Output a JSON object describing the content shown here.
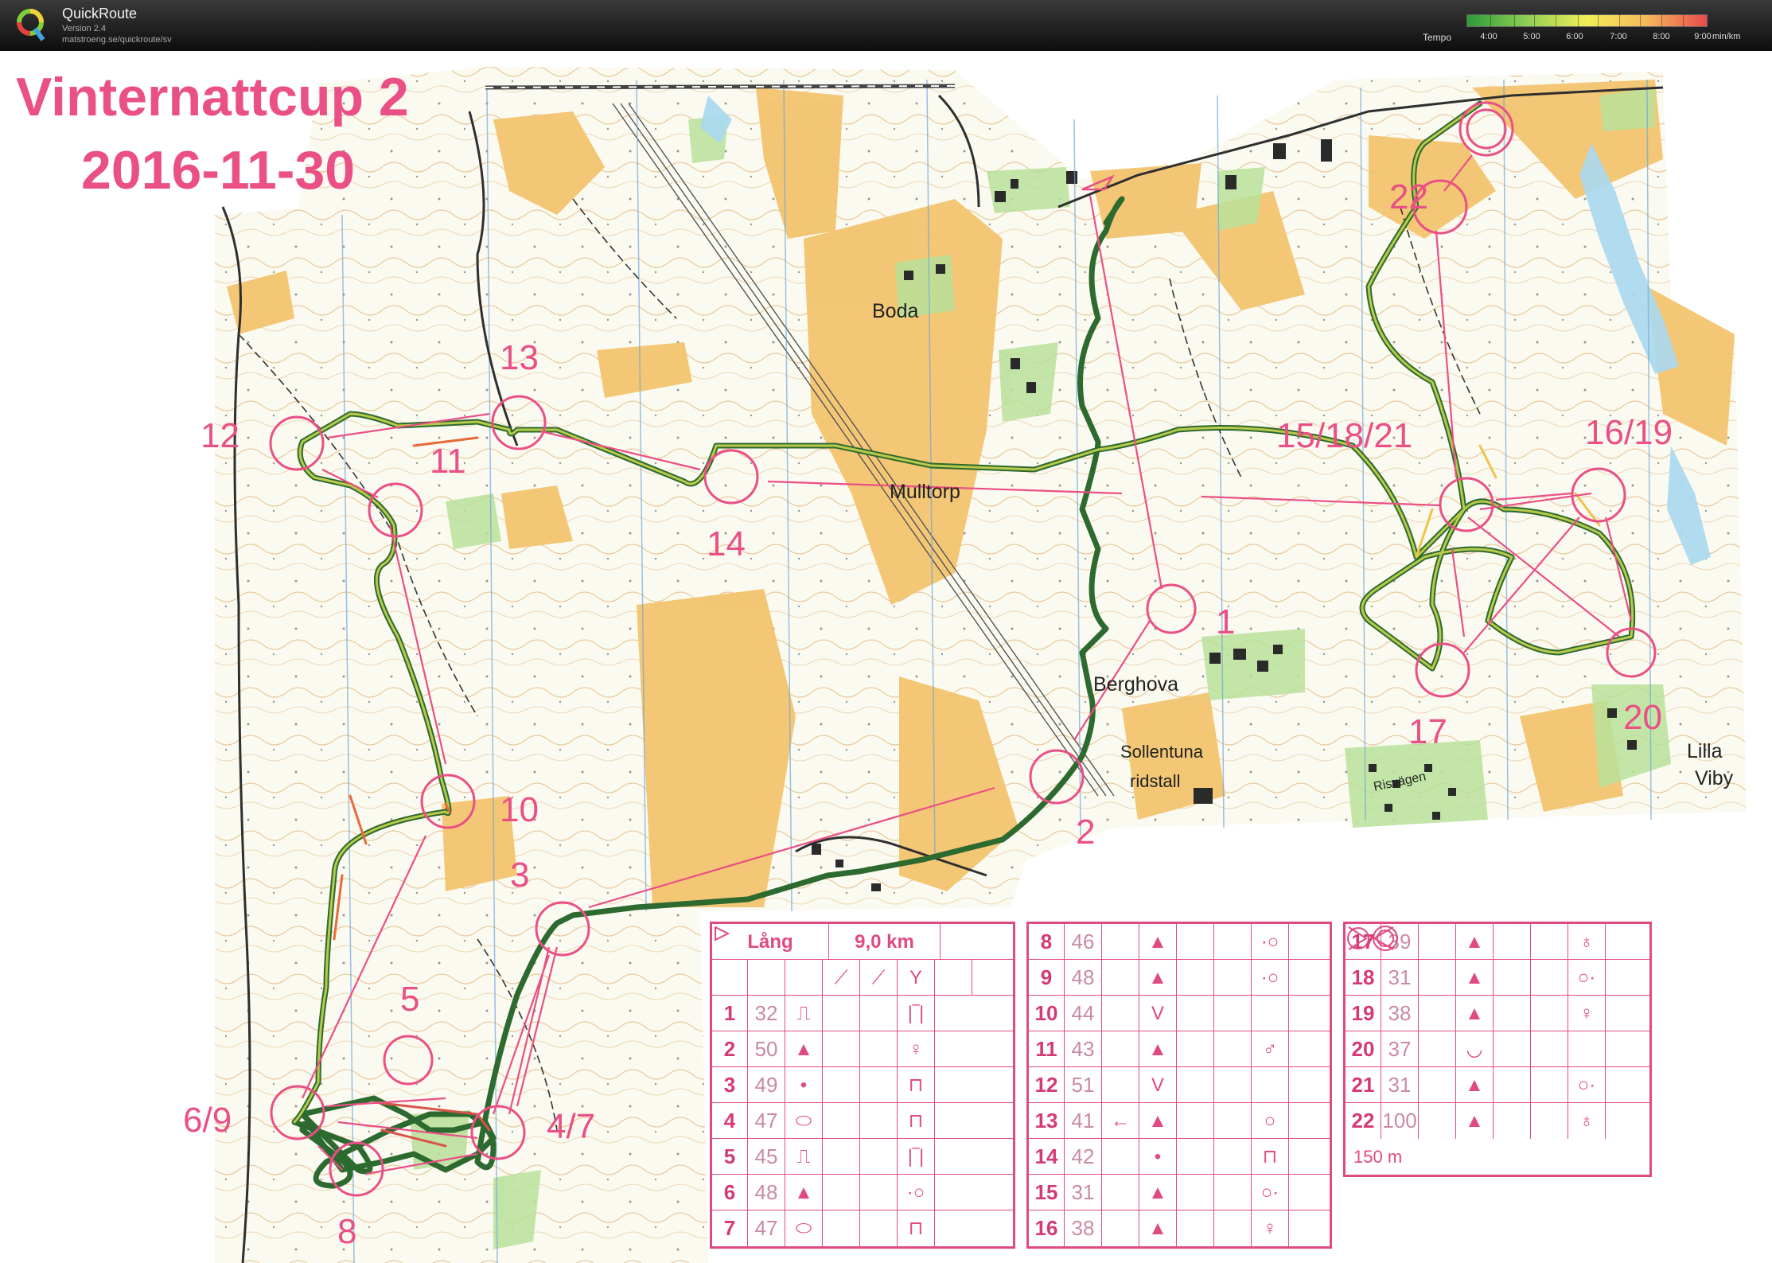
{
  "app": {
    "title": "QuickRoute",
    "version": "Version 2.4",
    "url": "matstroeng.se/quickroute/sv"
  },
  "tempo": {
    "label": "Tempo",
    "ticks": [
      "4:00",
      "5:00",
      "6:00",
      "7:00",
      "8:00",
      "9:00"
    ],
    "unit": "min/km",
    "colors": [
      "#2e9a3a",
      "#8fcf55",
      "#f2ee58",
      "#f4b85c",
      "#e64b4b"
    ]
  },
  "map": {
    "title": "Vinternattcup 2",
    "date": "2016-11-30",
    "place_names": {
      "boda": "Boda",
      "mulltorp": "Mulltorp",
      "berghova": "Berghova",
      "sollentuna": "Sollentuna",
      "ridstall": "ridstall",
      "lilla": "Lilla",
      "viby": "Viby",
      "risvagen": "Risvägen"
    },
    "control_labels": {
      "c1": "1",
      "c2": "2",
      "c3": "3",
      "c47": "4/7",
      "c5": "5",
      "c69": "6/9",
      "c8": "8",
      "c10": "10",
      "c11": "11",
      "c12": "12",
      "c13": "13",
      "c14": "14",
      "c151821": "15/18/21",
      "c1619": "16/19",
      "c17": "17",
      "c20": "20",
      "c22": "22"
    },
    "colors": {
      "course": "#ea4f86",
      "open_forest": "#f2c46e",
      "forest": "#fbfbf4",
      "green": "#b9e09a",
      "water": "#a8d8ef",
      "building": "#2a2a2a",
      "contour": "#c98a3a"
    }
  },
  "descriptions": {
    "course": "Lång",
    "length": "9,0 km",
    "marked_route": "150 m",
    "table1": [
      {
        "no": "1",
        "code": "32",
        "feature": "⎍",
        "detail": "|‾|"
      },
      {
        "no": "2",
        "code": "50",
        "feature": "▲",
        "detail": "♀"
      },
      {
        "no": "3",
        "code": "49",
        "feature": "•",
        "detail": "⊓"
      },
      {
        "no": "4",
        "code": "47",
        "feature": "⬭",
        "detail": "⊓"
      },
      {
        "no": "5",
        "code": "45",
        "feature": "⎍",
        "detail": "|‾|"
      },
      {
        "no": "6",
        "code": "48",
        "feature": "▲",
        "detail": "·○"
      },
      {
        "no": "7",
        "code": "47",
        "feature": "⬭",
        "detail": "⊓"
      }
    ],
    "table2": [
      {
        "no": "8",
        "code": "46",
        "feature": "▲",
        "detail": "·○"
      },
      {
        "no": "9",
        "code": "48",
        "feature": "▲",
        "detail": "·○"
      },
      {
        "no": "10",
        "code": "44",
        "feature": "V",
        "detail": ""
      },
      {
        "no": "11",
        "code": "43",
        "feature": "▲",
        "detail": "♂"
      },
      {
        "no": "12",
        "code": "51",
        "feature": "V",
        "detail": ""
      },
      {
        "no": "13",
        "code": "41",
        "feature": "▲",
        "detail": "○",
        "extra": "←"
      },
      {
        "no": "14",
        "code": "42",
        "feature": "•",
        "detail": "⊓"
      },
      {
        "no": "15",
        "code": "31",
        "feature": "▲",
        "detail": "○·"
      },
      {
        "no": "16",
        "code": "38",
        "feature": "▲",
        "detail": "♀"
      }
    ],
    "table3": [
      {
        "no": "17",
        "code": "39",
        "feature": "▲",
        "detail": "♁"
      },
      {
        "no": "18",
        "code": "31",
        "feature": "▲",
        "detail": "○·"
      },
      {
        "no": "19",
        "code": "38",
        "feature": "▲",
        "detail": "♀"
      },
      {
        "no": "20",
        "code": "37",
        "feature": "◡",
        "detail": ""
      },
      {
        "no": "21",
        "code": "31",
        "feature": "▲",
        "detail": "○·"
      },
      {
        "no": "22",
        "code": "100",
        "feature": "▲",
        "detail": "♁"
      }
    ]
  }
}
